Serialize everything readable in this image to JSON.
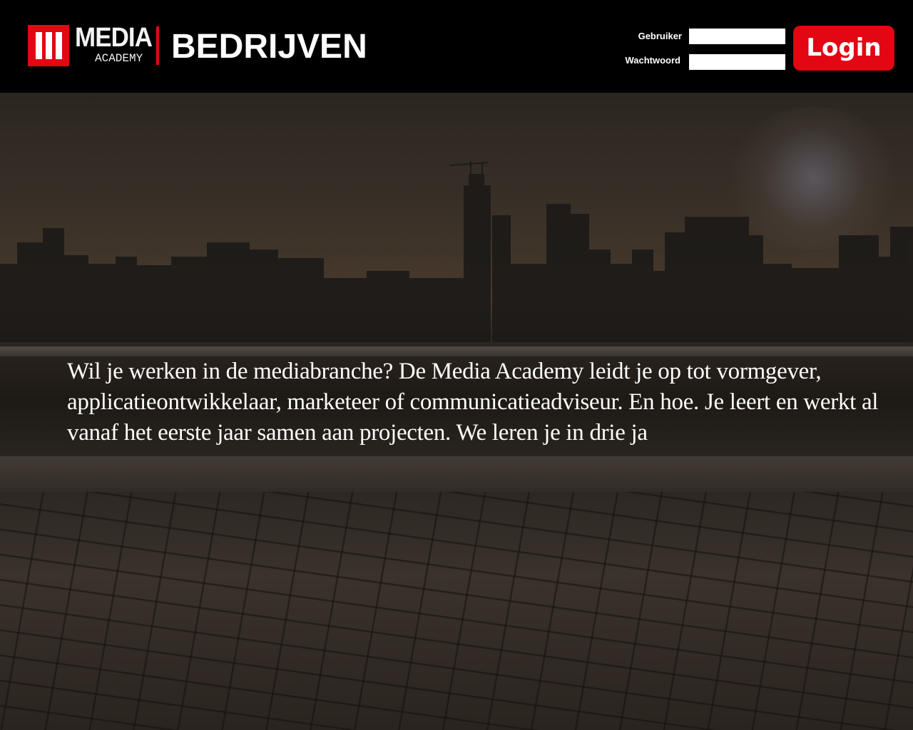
{
  "header": {
    "logo": {
      "main_text": "MEDIA",
      "sub_text": "ACADEMY",
      "brand_color": "#e30613"
    },
    "site_title": "BEDRIJVEN"
  },
  "login": {
    "username_label": "Gebruiker",
    "username_value": "",
    "password_label": "Wachtwoord",
    "password_value": "",
    "button_label": "Login",
    "button_color": "#e30613"
  },
  "hero": {
    "background_image": "city-skyline-terrace-photo",
    "intro_text": "Wil je werken in de mediabranche? De Media Academy leidt je op tot vormgever, applicatieontwikkelaar, marketeer of communicatieadviseur. En hoe. Je leert en werkt al vanaf het eerste jaar samen aan projecten. We leren je in drie ja"
  }
}
